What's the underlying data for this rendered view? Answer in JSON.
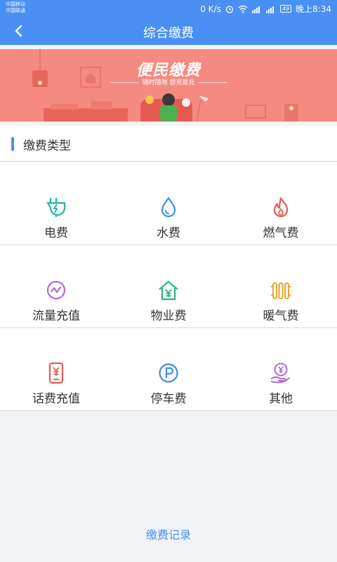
{
  "status_bar": {
    "carrier1": "中国移动",
    "carrier2": "中国联通",
    "speed": "0 K/s",
    "battery": "49",
    "time": "晚上8:34"
  },
  "header": {
    "title": "综合缴费"
  },
  "banner": {
    "title": "便民缴费",
    "subtitle": "随时随地 想充就充"
  },
  "section": {
    "title": "缴费类型"
  },
  "grid": [
    {
      "label": "电费",
      "icon": "plug-icon",
      "color": "#2bb3a3"
    },
    {
      "label": "水费",
      "icon": "water-drop-icon",
      "color": "#3a8fe0"
    },
    {
      "label": "燃气费",
      "icon": "flame-icon",
      "color": "#e35d52"
    },
    {
      "label": "流量充值",
      "icon": "wave-circle-icon",
      "color": "#b06ad6"
    },
    {
      "label": "物业费",
      "icon": "house-yen-icon",
      "color": "#2bb37f"
    },
    {
      "label": "暖气费",
      "icon": "radiator-icon",
      "color": "#e8a22f"
    },
    {
      "label": "话费充值",
      "icon": "phone-yen-icon",
      "color": "#e35d52"
    },
    {
      "label": "停车费",
      "icon": "parking-icon",
      "color": "#3a8fe0"
    },
    {
      "label": "其他",
      "icon": "hand-coin-icon",
      "color": "#b06ad6"
    }
  ],
  "footer": {
    "records_label": "缴费记录"
  }
}
